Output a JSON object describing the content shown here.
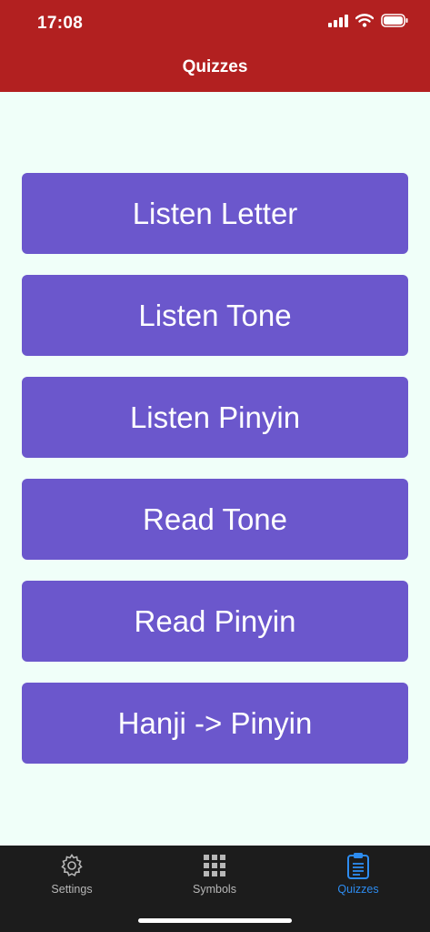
{
  "status_bar": {
    "time": "17:08",
    "icons": [
      "signal-icon",
      "wifi-icon",
      "battery-icon"
    ]
  },
  "header": {
    "title": "Quizzes",
    "background": "#b22020"
  },
  "quiz_buttons": [
    {
      "label": "Listen Letter"
    },
    {
      "label": "Listen Tone"
    },
    {
      "label": "Listen Pinyin"
    },
    {
      "label": "Read Tone"
    },
    {
      "label": "Read Pinyin"
    },
    {
      "label": "Hanji -> Pinyin"
    }
  ],
  "tabbar": {
    "tabs": [
      {
        "label": "Settings",
        "icon": "gear-icon",
        "active": false
      },
      {
        "label": "Symbols",
        "icon": "grid-icon",
        "active": false
      },
      {
        "label": "Quizzes",
        "icon": "clipboard-icon",
        "active": true
      }
    ]
  },
  "colors": {
    "button": "#6b57cc",
    "page_background": "#f0fff9",
    "tabbar_background": "#1c1c1c",
    "active_tab": "#2d8cf0",
    "inactive_tab": "#b7b7b7"
  }
}
